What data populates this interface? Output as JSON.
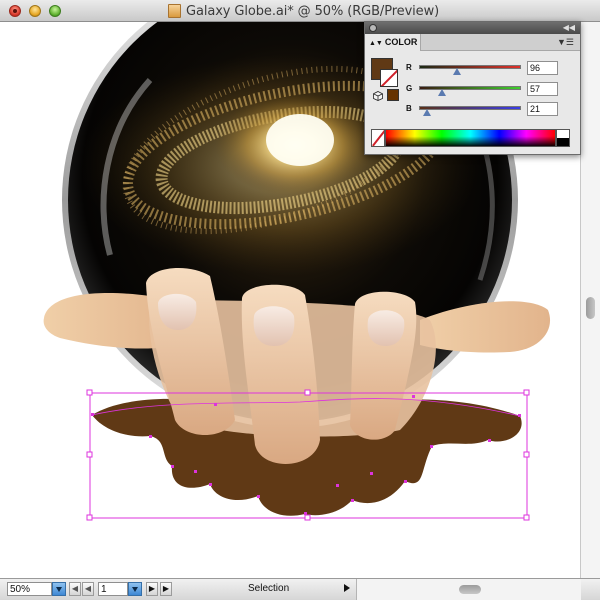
{
  "window": {
    "title": "Galaxy Globe.ai* @ 50% (RGB/Preview)"
  },
  "statusbar": {
    "zoom": "50%",
    "page": "1",
    "tool": "Selection"
  },
  "color_panel": {
    "tab_label": "COLOR",
    "fill_color": "#603915",
    "web_swatch_color": "#663300",
    "channels": [
      {
        "label": "R",
        "value": "96",
        "fraction": 0.376,
        "gradient": [
          "#1b2a14",
          "#e0302a"
        ]
      },
      {
        "label": "G",
        "value": "57",
        "fraction": 0.224,
        "gradient": [
          "#3b1c12",
          "#3ecf2c"
        ]
      },
      {
        "label": "B",
        "value": "21",
        "fraction": 0.082,
        "gradient": [
          "#5a3016",
          "#3a3de8"
        ]
      }
    ]
  },
  "colors": {
    "selection": "#dd33dd",
    "shadow": "#603915"
  },
  "icons": {
    "document": "illustrator-document-icon",
    "cube": "web-safe-cube-icon"
  }
}
